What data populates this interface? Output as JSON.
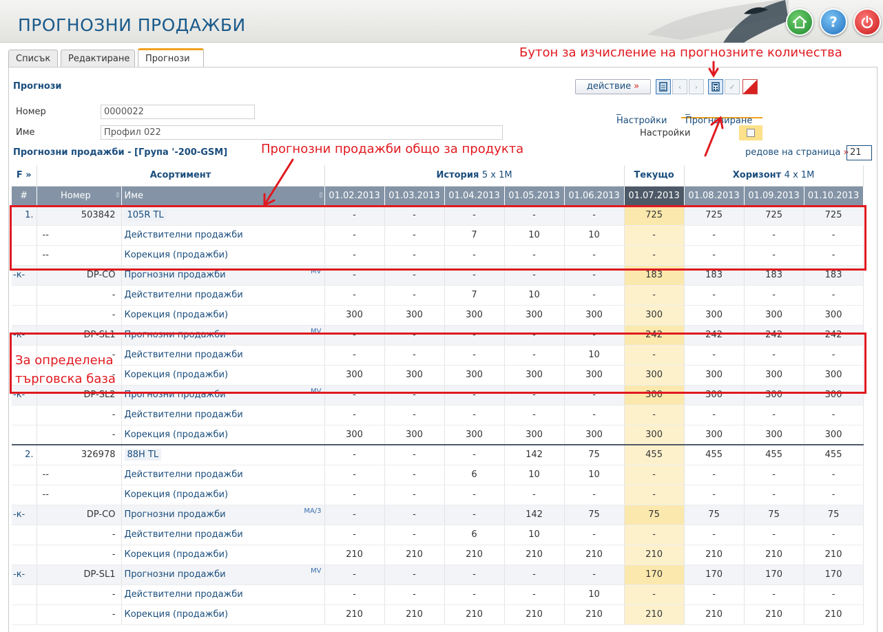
{
  "app": {
    "title": "ПРОГНОЗНИ ПРОДАЖБИ"
  },
  "tabs": [
    {
      "label": "Списък"
    },
    {
      "label": "Редактиране"
    },
    {
      "label": "Прогнози"
    }
  ],
  "toolbar": {
    "section_title": "Прогнози",
    "action_label": "действие",
    "action_arrow": "»"
  },
  "form": {
    "number_label": "Номер",
    "number_value": "0000022",
    "name_label": "Име",
    "name_value": "Профил 022",
    "settings_label": "Настройки"
  },
  "subtabs": {
    "settings": "_ Настройки",
    "forecasting": "_ Прогнозиране"
  },
  "grid_title": "Прогнозни продажби -  [Група '-200-GSM]",
  "rows_per_page": {
    "label": "редове на страница",
    "arrow": "»",
    "value": "21"
  },
  "annotations": {
    "calc_button": "Бутон за изчисление на прогнозните количества",
    "product_total": "Прогнозни продажби общо за продукта",
    "base_line1": "За определена",
    "base_line2": "търговска база"
  },
  "table": {
    "f_label": "F »",
    "group_headers": {
      "assortment": "Асортимент",
      "history": "История",
      "history_sub": "5 x 1M",
      "current": "Текущо",
      "horizon": "Хоризонт",
      "horizon_sub": "4 x 1M"
    },
    "columns": {
      "hash": "#",
      "number": "Номер",
      "name": "Име"
    },
    "dates": [
      "01.02.2013",
      "01.03.2013",
      "01.04.2013",
      "01.05.2013",
      "01.06.2013",
      "01.07.2013",
      "01.08.2013",
      "01.09.2013",
      "01.10.2013"
    ],
    "rows": [
      {
        "rn": "1.",
        "code": "503842",
        "name": "105R TL",
        "product": true,
        "method": "",
        "vals": [
          "-",
          "-",
          "-",
          "-",
          "-",
          "725",
          "725",
          "725",
          "725"
        ],
        "hl": true
      },
      {
        "rn": "",
        "code": "--",
        "name": "Действителни продажби",
        "method": "",
        "vals": [
          "-",
          "-",
          "7",
          "10",
          "10",
          "-",
          "-",
          "-",
          "-"
        ]
      },
      {
        "rn": "",
        "code": "--",
        "name": "Корекция (продажби)",
        "method": "",
        "vals": [
          "-",
          "-",
          "-",
          "-",
          "-",
          "-",
          "-",
          "-",
          "-"
        ]
      },
      {
        "rn": "-к-",
        "code": "DP-CO",
        "name": "Прогнозни продажби",
        "method": "MV",
        "vals": [
          "-",
          "-",
          "-",
          "-",
          "-",
          "183",
          "183",
          "183",
          "183"
        ],
        "hl": true
      },
      {
        "rn": "",
        "code": "-",
        "name": "Действителни продажби",
        "method": "",
        "vals": [
          "-",
          "-",
          "7",
          "10",
          "-",
          "-",
          "-",
          "-",
          "-"
        ]
      },
      {
        "rn": "",
        "code": "-",
        "name": "Корекция (продажби)",
        "method": "",
        "vals": [
          "300",
          "300",
          "300",
          "300",
          "300",
          "300",
          "300",
          "300",
          "300"
        ]
      },
      {
        "rn": "-к-",
        "code": "DP-SL1",
        "name": "Прогнозни продажби",
        "method": "MV",
        "vals": [
          "-",
          "-",
          "-",
          "-",
          "-",
          "242",
          "242",
          "242",
          "242"
        ],
        "hl": true
      },
      {
        "rn": "",
        "code": "-",
        "name": "Действителни продажби",
        "method": "",
        "vals": [
          "-",
          "-",
          "-",
          "-",
          "10",
          "-",
          "-",
          "-",
          "-"
        ]
      },
      {
        "rn": "",
        "code": "-",
        "name": "Корекция (продажби)",
        "method": "",
        "vals": [
          "300",
          "300",
          "300",
          "300",
          "300",
          "300",
          "300",
          "300",
          "300"
        ]
      },
      {
        "rn": "-к-",
        "code": "DP-SL2",
        "name": "Прогнозни продажби",
        "method": "MV",
        "vals": [
          "-",
          "-",
          "-",
          "-",
          "-",
          "300",
          "300",
          "300",
          "300"
        ],
        "hl": true
      },
      {
        "rn": "",
        "code": "-",
        "name": "Действителни продажби",
        "method": "",
        "vals": [
          "-",
          "-",
          "-",
          "-",
          "-",
          "-",
          "-",
          "-",
          "-"
        ]
      },
      {
        "rn": "",
        "code": "-",
        "name": "Корекция (продажби)",
        "method": "",
        "vals": [
          "300",
          "300",
          "300",
          "300",
          "300",
          "300",
          "300",
          "300",
          "300"
        ]
      },
      {
        "rn": "2.",
        "code": "326978",
        "name": "88H TL",
        "product": true,
        "sep": true,
        "method": "",
        "vals": [
          "-",
          "-",
          "-",
          "142",
          "75",
          "455",
          "455",
          "455",
          "455"
        ]
      },
      {
        "rn": "",
        "code": "--",
        "name": "Действителни продажби",
        "method": "",
        "vals": [
          "-",
          "-",
          "6",
          "10",
          "10",
          "-",
          "-",
          "-",
          "-"
        ]
      },
      {
        "rn": "",
        "code": "--",
        "name": "Корекция (продажби)",
        "method": "",
        "vals": [
          "-",
          "-",
          "-",
          "-",
          "-",
          "-",
          "-",
          "-",
          "-"
        ]
      },
      {
        "rn": "-к-",
        "code": "DP-CO",
        "name": "Прогнозни продажби",
        "method": "MA/3",
        "vals": [
          "-",
          "-",
          "-",
          "142",
          "75",
          "75",
          "75",
          "75",
          "75"
        ],
        "hl": true
      },
      {
        "rn": "",
        "code": "-",
        "name": "Действителни продажби",
        "method": "",
        "vals": [
          "-",
          "-",
          "6",
          "10",
          "-",
          "-",
          "-",
          "-",
          "-"
        ]
      },
      {
        "rn": "",
        "code": "-",
        "name": "Корекция (продажби)",
        "method": "",
        "vals": [
          "210",
          "210",
          "210",
          "210",
          "210",
          "210",
          "210",
          "210",
          "210"
        ]
      },
      {
        "rn": "-к-",
        "code": "DP-SL1",
        "name": "Прогнозни продажби",
        "method": "MV",
        "vals": [
          "-",
          "-",
          "-",
          "-",
          "-",
          "170",
          "170",
          "170",
          "170"
        ],
        "hl": true
      },
      {
        "rn": "",
        "code": "-",
        "name": "Действителни продажби",
        "method": "",
        "vals": [
          "-",
          "-",
          "-",
          "-",
          "10",
          "-",
          "-",
          "-",
          "-"
        ]
      },
      {
        "rn": "",
        "code": "-",
        "name": "Корекция (продажби)",
        "method": "",
        "vals": [
          "210",
          "210",
          "210",
          "210",
          "210",
          "210",
          "210",
          "210",
          "210"
        ]
      }
    ]
  },
  "colors": {
    "accent": "#1a4d7c",
    "annotation": "#e0191f",
    "current_col": "#fdf1cc",
    "header_bg": "#8494a6"
  }
}
